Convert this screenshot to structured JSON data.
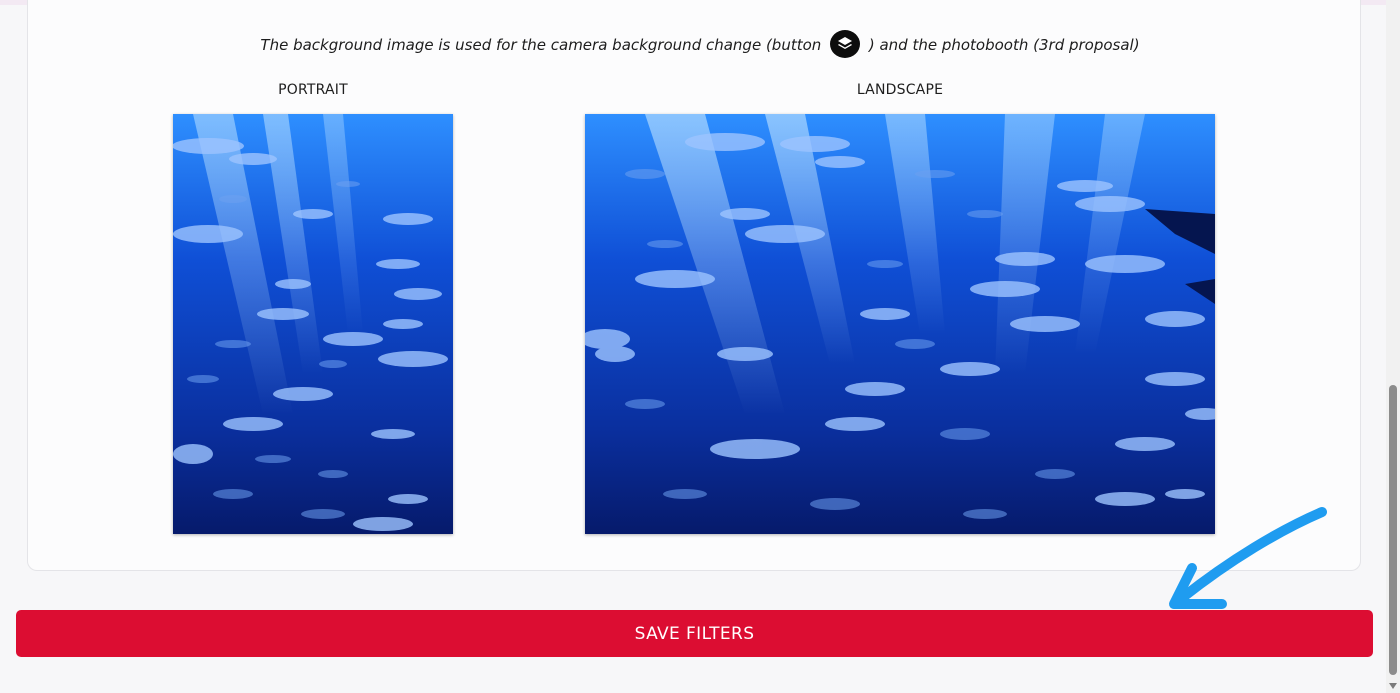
{
  "note": {
    "text_before": "The background image is used for the camera background change (button",
    "text_after": ") and the photobooth (3rd proposal)",
    "button_icon": "layers-icon"
  },
  "portrait": {
    "label": "PORTRAIT"
  },
  "landscape": {
    "label": "LANDSCAPE"
  },
  "save_button": {
    "label": "SAVE FILTERS"
  },
  "colors": {
    "accent": "#dc0d32",
    "annotation_arrow": "#1f9cf0",
    "ocean_light": "#2e8fff",
    "ocean_dark": "#061a6b"
  }
}
